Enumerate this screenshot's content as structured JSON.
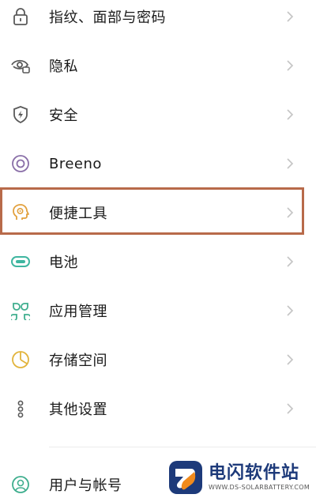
{
  "settings": {
    "items": [
      {
        "label": "指纹、面部与密码",
        "icon": "lock-icon"
      },
      {
        "label": "隐私",
        "icon": "privacy-eye-icon"
      },
      {
        "label": "安全",
        "icon": "shield-icon"
      },
      {
        "label": "Breeno",
        "icon": "breeno-icon"
      },
      {
        "label": "便捷工具",
        "icon": "convenience-tools-icon"
      },
      {
        "label": "电池",
        "icon": "battery-icon"
      },
      {
        "label": "应用管理",
        "icon": "app-management-icon"
      },
      {
        "label": "存储空间",
        "icon": "storage-pie-icon"
      },
      {
        "label": "其他设置",
        "icon": "more-settings-icon"
      },
      {
        "label": "用户与帐号",
        "icon": "user-account-icon"
      }
    ],
    "highlighted_item": "便捷工具"
  },
  "watermark": {
    "title": "电闪软件站",
    "subtitle": "WWW.DS-SOLARBATTERY.COM"
  },
  "colors": {
    "icon_stroke": "#5a5a5a",
    "battery_green": "#3fb6a0",
    "app_mgmt_green": "#3fae8e",
    "storage_yellow": "#e2b43c",
    "breeno_purple": "#8a6fa8",
    "highlight_border": "#b86a4a",
    "watermark_blue": "#1d3a7a",
    "watermark_orange": "#f08a1c"
  }
}
